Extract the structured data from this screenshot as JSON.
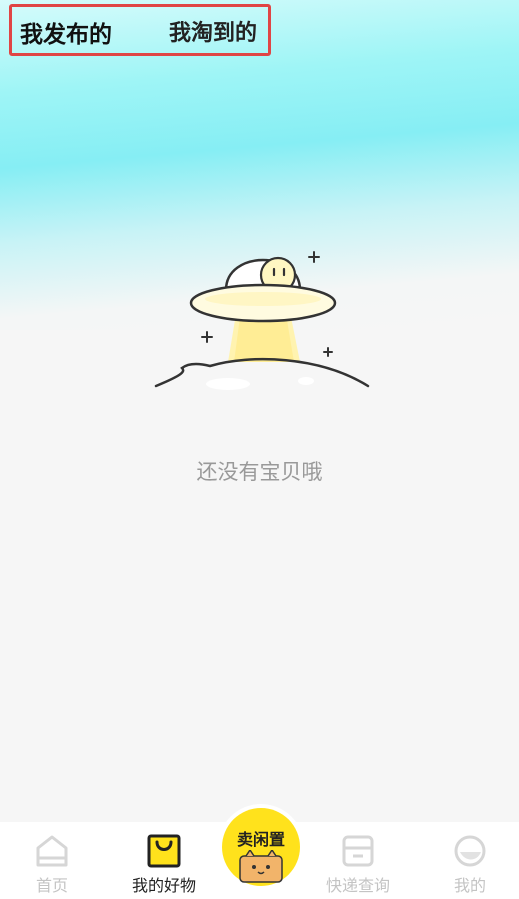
{
  "tabs": {
    "published": "我发布的",
    "bought": "我淘到的"
  },
  "empty_state": {
    "message": "还没有宝贝哦",
    "illustration": "ufo-illustration"
  },
  "bottom_nav": {
    "home": "首页",
    "my_goods": "我的好物",
    "sell": "卖闲置",
    "express": "快递查询",
    "me": "我的"
  },
  "colors": {
    "accent_yellow": "#ffe21c",
    "tab_highlight": "#38e8f0",
    "inactive_nav": "#c4c4c4"
  }
}
